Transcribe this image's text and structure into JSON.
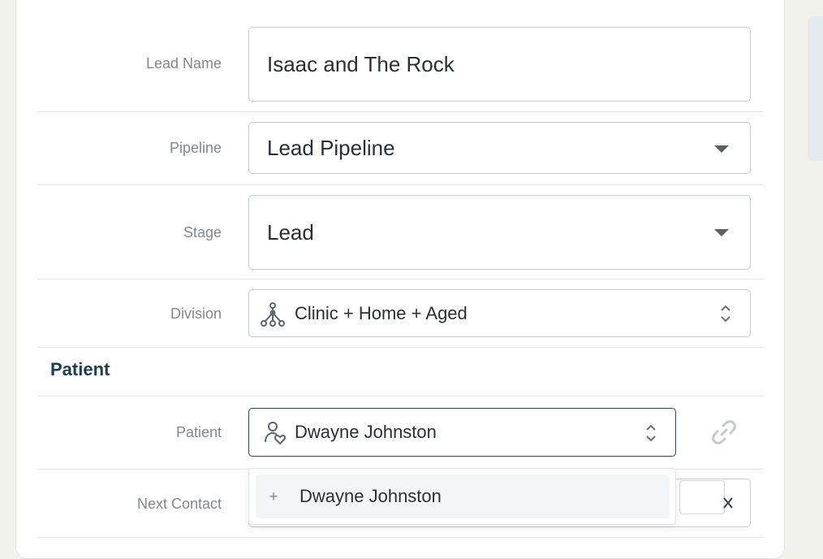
{
  "form": {
    "lead_name": {
      "label": "Lead Name",
      "value": "Isaac and The Rock"
    },
    "pipeline": {
      "label": "Pipeline",
      "value": "Lead Pipeline"
    },
    "stage": {
      "label": "Stage",
      "value": "Lead"
    },
    "division": {
      "label": "Division",
      "value": "Clinic + Home + Aged",
      "icon": "hierarchy-icon"
    },
    "patient_section": {
      "title": "Patient"
    },
    "patient": {
      "label": "Patient",
      "value": "Dwayne Johnston",
      "icon": "patient-heart-icon"
    },
    "next_contact": {
      "label": "Next Contact"
    }
  },
  "dropdown": {
    "options": [
      {
        "prefix": "+",
        "label": "Dwayne Johnston"
      }
    ]
  },
  "colors": {
    "accent": "#1d4050",
    "border": "#c9cdd0",
    "label": "#808990"
  }
}
